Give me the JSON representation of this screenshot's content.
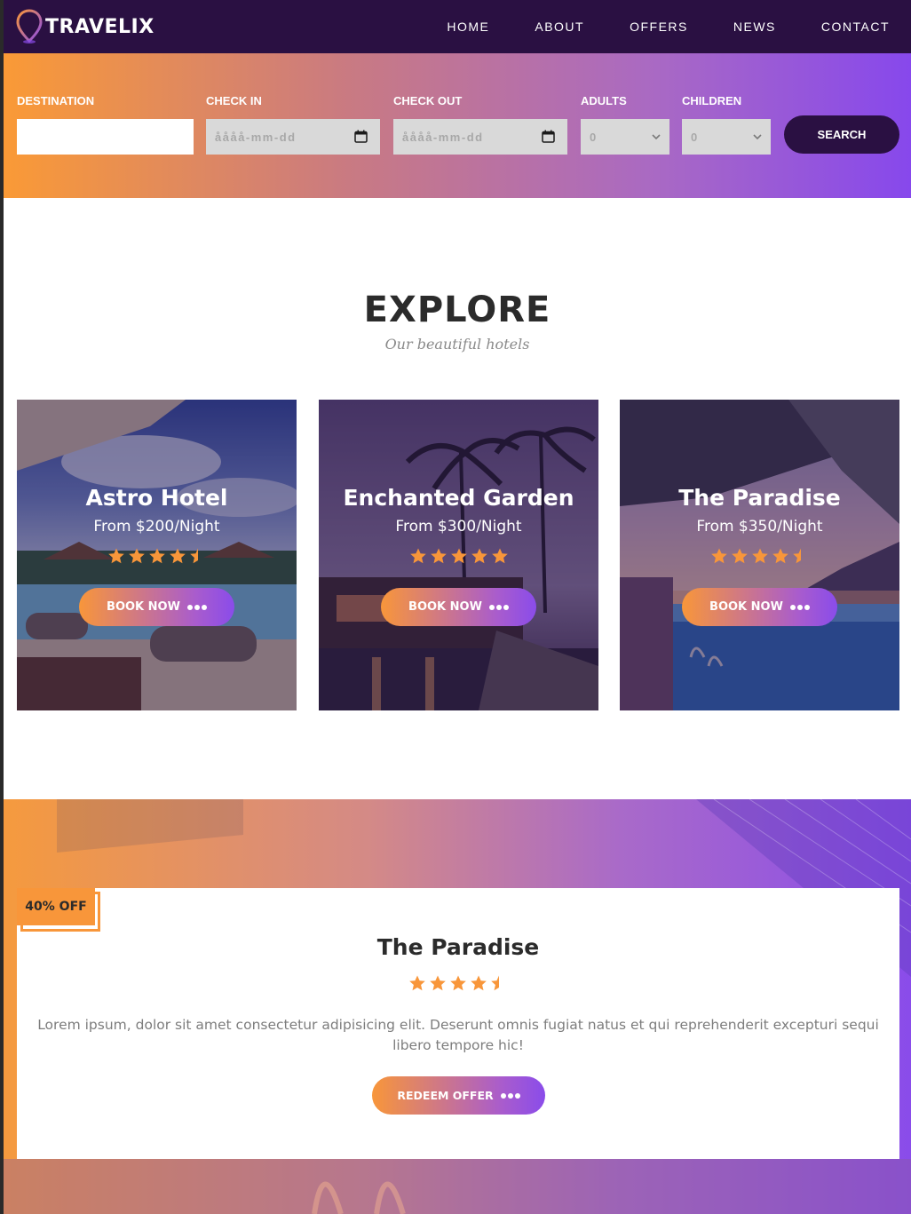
{
  "brand": {
    "name": "TRAVELIX",
    "accent": "#8a4cea",
    "nav_bg": "#2a1042",
    "orange": "#f8963a"
  },
  "nav": [
    {
      "label": "HOME"
    },
    {
      "label": "ABOUT"
    },
    {
      "label": "OFFERS"
    },
    {
      "label": "NEWS"
    },
    {
      "label": "CONTACT"
    }
  ],
  "search": {
    "destination_label": "DESTINATION",
    "destination_value": "",
    "checkin_label": "CHECK IN",
    "checkin_placeholder": "åååå-mm-dd",
    "checkout_label": "CHECK OUT",
    "checkout_placeholder": "åååå-mm-dd",
    "adults_label": "ADULTS",
    "adults_value": "0",
    "children_label": "CHILDREN",
    "children_value": "0",
    "button_label": "SEARCH"
  },
  "explore": {
    "title": "EXPLORE",
    "subtitle": "Our beautiful hotels",
    "hotels": [
      {
        "name": "Astro Hotel",
        "price": "From $200/Night",
        "rating": 4.5,
        "button": "BOOK NOW"
      },
      {
        "name": "Enchanted Garden",
        "price": "From $300/Night",
        "rating": 5,
        "button": "BOOK NOW"
      },
      {
        "name": "The Paradise",
        "price": "From $350/Night",
        "rating": 4.5,
        "button": "BOOK NOW"
      }
    ]
  },
  "offer": {
    "badge": "40% OFF",
    "title": "The Paradise",
    "rating": 4.5,
    "description": "Lorem ipsum, dolor sit amet consectetur adipisicing elit. Deserunt omnis fugiat natus et qui reprehenderit excepturi sequi libero tempore hic!",
    "button": "REDEEM OFFER"
  },
  "icons": [
    "map-pin-icon",
    "calendar-icon",
    "chevron-down-icon",
    "star-icon",
    "half-star-icon",
    "dots-icon"
  ]
}
